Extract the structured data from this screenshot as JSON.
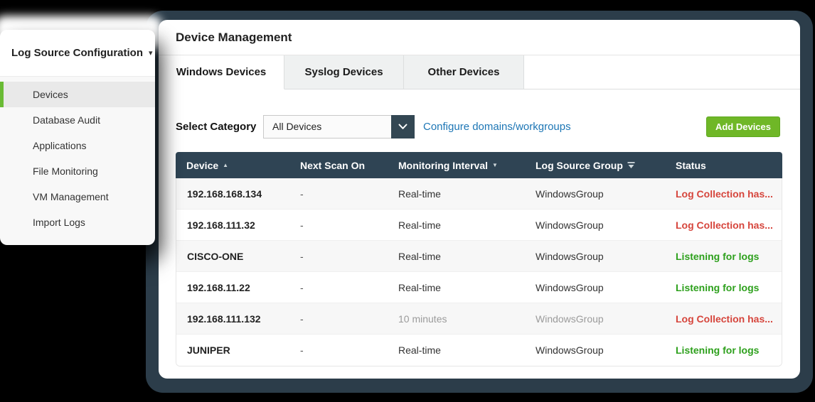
{
  "sidebar": {
    "title": "Log Source Configuration",
    "items": [
      {
        "label": "Devices",
        "active": true
      },
      {
        "label": "Database Audit",
        "active": false
      },
      {
        "label": "Applications",
        "active": false
      },
      {
        "label": "File Monitoring",
        "active": false
      },
      {
        "label": "VM Management",
        "active": false
      },
      {
        "label": "Import Logs",
        "active": false
      }
    ]
  },
  "panel": {
    "title": "Device Management",
    "tabs": [
      {
        "label": "Windows Devices",
        "active": true
      },
      {
        "label": "Syslog Devices",
        "active": false
      },
      {
        "label": "Other Devices",
        "active": false
      }
    ],
    "toolbar": {
      "category_label": "Select Category",
      "category_value": "All Devices",
      "configure_link": "Configure domains/workgroups",
      "add_button": "Add Devices"
    },
    "table": {
      "columns": [
        {
          "label": "Device",
          "sort": "asc"
        },
        {
          "label": "Next Scan On",
          "sort": null
        },
        {
          "label": "Monitoring Interval",
          "sort": "desc"
        },
        {
          "label": "Log Source Group",
          "filter": true
        },
        {
          "label": "Status"
        }
      ],
      "rows": [
        {
          "device": "192.168.168.134",
          "next_scan": "-",
          "interval": "Real-time",
          "group": "WindowsGroup",
          "status": "Log Collection has...",
          "status_type": "error",
          "muted": false
        },
        {
          "device": "192.168.111.32",
          "next_scan": "-",
          "interval": "Real-time",
          "group": "WindowsGroup",
          "status": "Log Collection has...",
          "status_type": "error",
          "muted": false
        },
        {
          "device": "CISCO-ONE",
          "next_scan": "-",
          "interval": "Real-time",
          "group": "WindowsGroup",
          "status": "Listening for logs",
          "status_type": "ok",
          "muted": false
        },
        {
          "device": "192.168.11.22",
          "next_scan": "-",
          "interval": "Real-time",
          "group": "WindowsGroup",
          "status": "Listening for logs",
          "status_type": "ok",
          "muted": false
        },
        {
          "device": "192.168.111.132",
          "next_scan": "-",
          "interval": "10 minutes",
          "group": "WindowsGroup",
          "status": "Log Collection has...",
          "status_type": "error",
          "muted": true
        },
        {
          "device": "JUNIPER",
          "next_scan": "-",
          "interval": "Real-time",
          "group": "WindowsGroup",
          "status": "Listening for logs",
          "status_type": "ok",
          "muted": false
        }
      ]
    }
  },
  "icons": {
    "caret_down": "▾",
    "sort_asc": "▲",
    "sort_desc": "▼",
    "chevron_down": "chevron-down",
    "filter": "filter-funnel"
  },
  "colors": {
    "frame": "#2c3d4a",
    "table_header": "#2f4454",
    "accent_green": "#6fb727",
    "sidebar_accent": "#6abb35",
    "link_blue": "#1d76b5",
    "status_error": "#d6453c",
    "status_ok": "#2da01c"
  }
}
